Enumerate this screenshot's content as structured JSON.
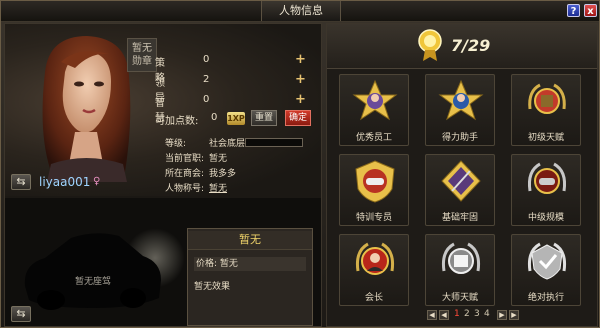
{
  "window": {
    "title": "人物信息",
    "help_label": "?",
    "close_label": "x"
  },
  "character": {
    "medal_label": "暂无\n勋章",
    "stats": [
      {
        "label": "策略",
        "value": "0"
      },
      {
        "label": "领导",
        "value": "2"
      },
      {
        "label": "智慧",
        "value": "0"
      }
    ],
    "points_label": "可加点数:",
    "points_value": "0",
    "points_icon_text": "1XP",
    "reset_label": "重置",
    "confirm_label": "确定",
    "info": [
      {
        "label": "等级:",
        "value": "社会底层"
      },
      {
        "label": "当前官职:",
        "value": "暂无"
      },
      {
        "label": "所在商会:",
        "value": "我多多"
      },
      {
        "label": "人物称号:",
        "value": "暂无"
      }
    ],
    "player_name": "liyaa001",
    "gender_icon": "female-icon"
  },
  "garage": {
    "car_label": "暂无座驾"
  },
  "item_card": {
    "title": "暂无",
    "price": "价格: 暂无",
    "effect": "暂无效果"
  },
  "achievements": {
    "progress": "7/29",
    "colors": {
      "gold": "#e8c04a",
      "red": "#c23a2a",
      "silver": "#c7c7c7"
    },
    "badges": [
      {
        "label": "优秀员工",
        "icon": "star-person-icon"
      },
      {
        "label": "得力助手",
        "icon": "star-person-icon"
      },
      {
        "label": "初级天赋",
        "icon": "book-laurel-icon"
      },
      {
        "label": "特训专员",
        "icon": "car-shield-icon"
      },
      {
        "label": "基础牢固",
        "icon": "sword-shield-icon"
      },
      {
        "label": "中级规模",
        "icon": "car-laurel-icon"
      },
      {
        "label": "会长",
        "icon": "person-shield-icon"
      },
      {
        "label": "大师天赋",
        "icon": "book-laurel-icon"
      },
      {
        "label": "绝对执行",
        "icon": "silver-laurel-icon"
      }
    ],
    "pager": {
      "prev_first": "◀",
      "prev": "◀",
      "pages": [
        "1",
        "2",
        "3",
        "4"
      ],
      "current": "1",
      "next": "▶",
      "next_last": "▶"
    }
  }
}
